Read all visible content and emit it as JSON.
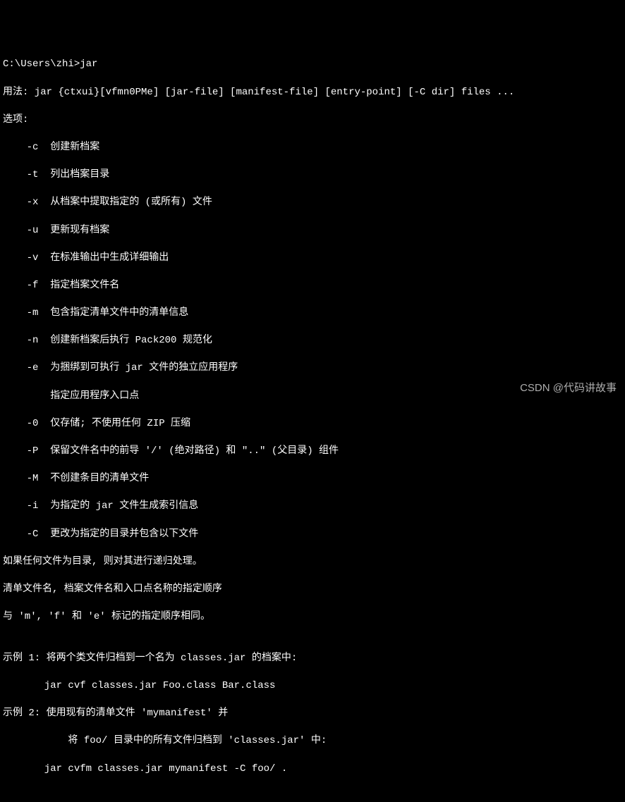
{
  "terminal": {
    "prompt_line": "C:\\Users\\zhi>jar",
    "usage_line": "用法: jar {ctxui}[vfmn0PMe] [jar-file] [manifest-file] [entry-point] [-C dir] files ...",
    "options_label": "选项:",
    "options": [
      "    -c  创建新档案",
      "    -t  列出档案目录",
      "    -x  从档案中提取指定的 (或所有) 文件",
      "    -u  更新现有档案",
      "    -v  在标准输出中生成详细输出",
      "    -f  指定档案文件名",
      "    -m  包含指定清单文件中的清单信息",
      "    -n  创建新档案后执行 Pack200 规范化",
      "    -e  为捆绑到可执行 jar 文件的独立应用程序",
      "        指定应用程序入口点",
      "    -0  仅存储; 不使用任何 ZIP 压缩",
      "    -P  保留文件名中的前导 '/' (绝对路径) 和 \"..\" (父目录) 组件",
      "    -M  不创建条目的清单文件",
      "    -i  为指定的 jar 文件生成索引信息",
      "    -C  更改为指定的目录并包含以下文件"
    ],
    "notes": [
      "如果任何文件为目录, 则对其进行递归处理。",
      "清单文件名, 档案文件名和入口点名称的指定顺序",
      "与 'm', 'f' 和 'e' 标记的指定顺序相同。",
      "",
      "示例 1: 将两个类文件归档到一个名为 classes.jar 的档案中:",
      "       jar cvf classes.jar Foo.class Bar.class",
      "示例 2: 使用现有的清单文件 'mymanifest' 并",
      "           将 foo/ 目录中的所有文件归档到 'classes.jar' 中:",
      "       jar cvfm classes.jar mymanifest -C foo/ ."
    ]
  },
  "watermark": "CSDN @代码讲故事"
}
